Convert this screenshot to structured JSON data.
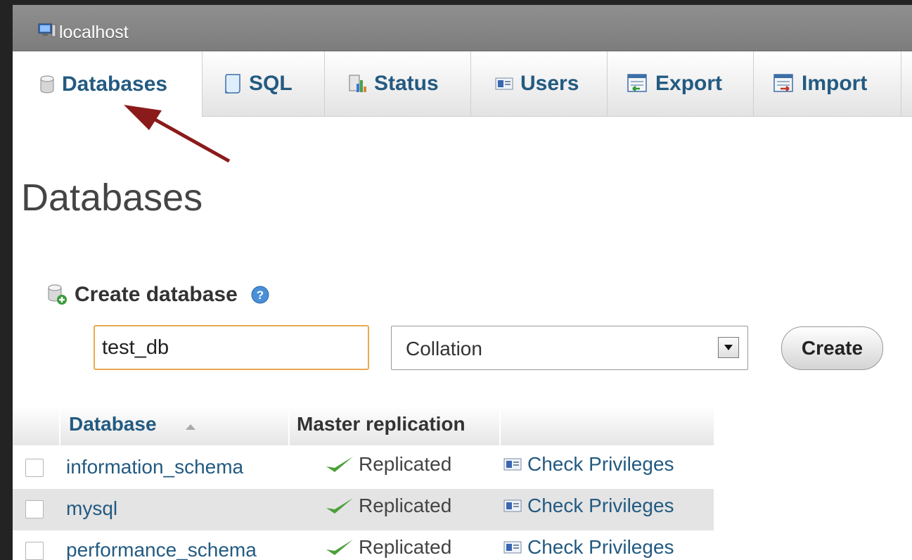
{
  "server": {
    "label": "localhost",
    "icon": "server-icon"
  },
  "tabs": [
    {
      "label": "Databases",
      "icon": "database-icon",
      "active": true
    },
    {
      "label": "SQL",
      "icon": "sql-scroll-icon"
    },
    {
      "label": "Status",
      "icon": "status-chart-icon"
    },
    {
      "label": "Users",
      "icon": "users-card-icon"
    },
    {
      "label": "Export",
      "icon": "export-icon"
    },
    {
      "label": "Import",
      "icon": "import-icon"
    }
  ],
  "page_title": "Databases",
  "create": {
    "heading": "Create database",
    "input_value": "test_db",
    "collation": "Collation",
    "button": "Create"
  },
  "table": {
    "headers": {
      "database": "Database",
      "replication": "Master replication"
    },
    "rows": [
      {
        "name": "information_schema",
        "replication": "Replicated",
        "action": "Check Privileges"
      },
      {
        "name": "mysql",
        "replication": "Replicated",
        "action": "Check Privileges"
      },
      {
        "name": "performance_schema",
        "replication": "Replicated",
        "action": "Check Privileges"
      }
    ]
  },
  "colors": {
    "link": "#235a81",
    "annotation_arrow": "#8b1a1a",
    "input_focus": "#e8a952"
  }
}
